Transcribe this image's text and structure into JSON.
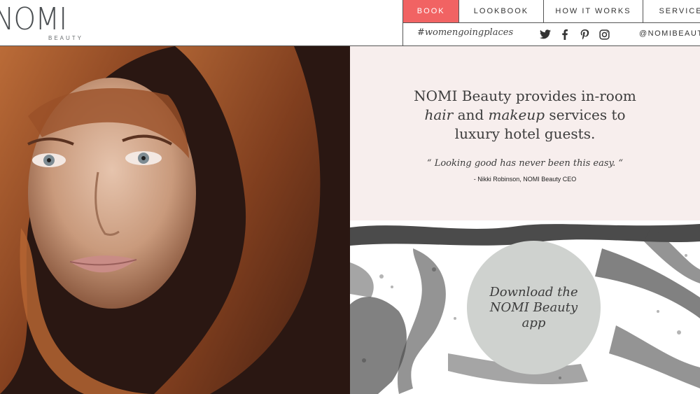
{
  "logo": {
    "main": "NOMI",
    "sub": "BEAUTY"
  },
  "nav": {
    "book": "BOOK",
    "lookbook": "LOOKBOOK",
    "how_it_works": "HOW IT WORKS",
    "services": "SERVICES"
  },
  "subnav": {
    "hashtag": "#womengoingplaces",
    "handle": "@NOMIBEAUTY",
    "icons": [
      "twitter-icon",
      "facebook-icon",
      "pinterest-icon",
      "instagram-icon"
    ]
  },
  "intro": {
    "line1": "NOMI Beauty provides in-room",
    "hair": "hair",
    "and": " and ",
    "makeup": "makeup",
    "services_to": " services to",
    "line3": "luxury hotel guests.",
    "quote": "“ Looking good has never been this easy. “",
    "author": "- Nikki Robinson, NOMI Beauty CEO"
  },
  "download": {
    "label": "Download the NOMI Beauty app"
  },
  "colors": {
    "accent": "#f16363",
    "intro_bg": "#f7eeed",
    "circle": "#cfd2cf"
  }
}
